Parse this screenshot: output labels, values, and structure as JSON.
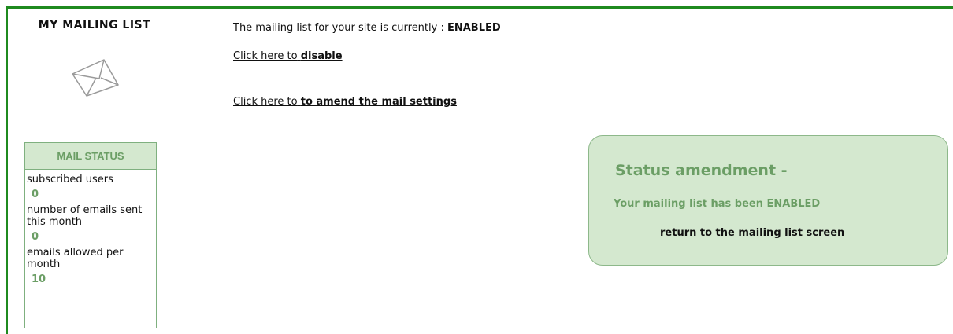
{
  "sidebar": {
    "title": "MY MAILING LIST",
    "envelope_icon": "envelope-icon",
    "mail_status": {
      "header": "MAIL STATUS",
      "stats": [
        {
          "label": "subscribed users",
          "value": "0"
        },
        {
          "label": "number of emails sent this month",
          "value": "0"
        },
        {
          "label": "emails allowed per month",
          "value": "10"
        }
      ]
    }
  },
  "main": {
    "status_prefix": "The mailing list for your site is currently :",
    "status_value": "ENABLED",
    "disable_link": {
      "prefix": "Click here to",
      "action": "disable"
    },
    "amend_link": {
      "prefix": "Click here to",
      "action": "to amend the mail settings"
    }
  },
  "notice": {
    "title": "Status amendment -",
    "message": "Your mailing list has been ENABLED",
    "return_link": "return to the mailing list screen"
  },
  "colors": {
    "frame": "#1f8a1f",
    "accent_green": "#6b9e65",
    "panel_bg": "#d4e8cf"
  }
}
